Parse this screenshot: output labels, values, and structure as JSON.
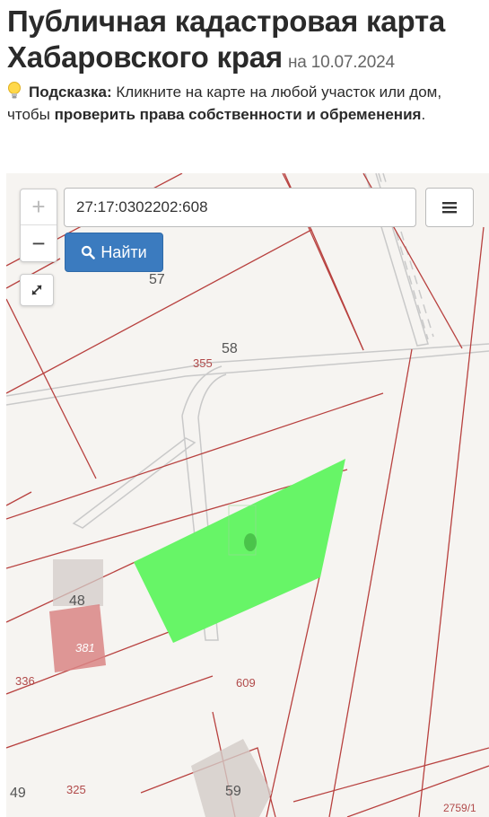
{
  "header": {
    "title_line1": "Публичная кадастровая карта",
    "title_line2": "Хабаровского края",
    "date": "на 10.07.2024"
  },
  "hint": {
    "icon": "lightbulb-icon",
    "label": "Подсказка:",
    "text1": " Кликните на карте на любой участок или дом, чтобы ",
    "bold": "проверить права собственности и обременения",
    "end": "."
  },
  "map": {
    "search_value": "27:17:0302202:608",
    "find_label": "Найти",
    "zoom_in": "+",
    "zoom_out": "−",
    "labels": {
      "l57": "57",
      "l58": "58",
      "l355": "355",
      "l48": "48",
      "l381": "381",
      "l336": "336",
      "l609": "609",
      "l49": "49",
      "l325": "325",
      "l59": "59",
      "l2759": "2759/1"
    },
    "colors": {
      "parcel_highlight": "#67f567",
      "boundary": "#b8413f",
      "building_red": "#d98585",
      "building_grey": "#d3ccc8",
      "button_blue": "#3b7bbf"
    }
  }
}
